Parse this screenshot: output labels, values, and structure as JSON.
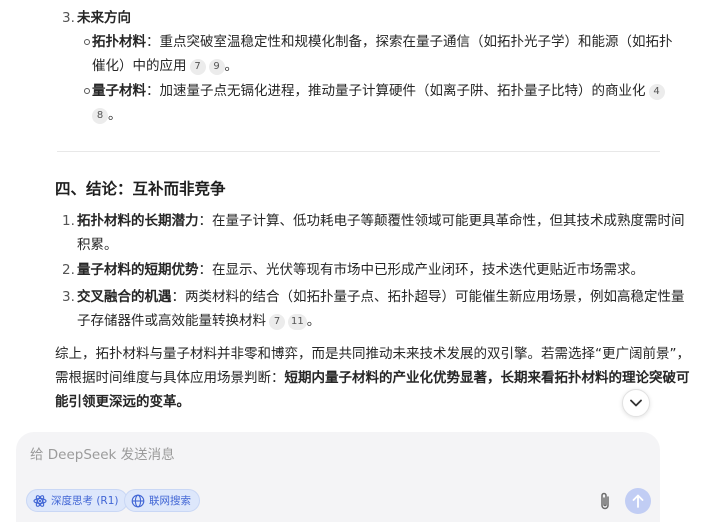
{
  "section3": {
    "num": "3.",
    "title": "未来方向",
    "items": [
      {
        "label": "拓扑材料",
        "text1": "：重点突破室温稳定性和规模化制备，探索在量子通信（如拓扑光子学）和能源（如拓扑",
        "text2": "催化）中的应用",
        "cites": [
          "7",
          "9"
        ],
        "end": "。"
      },
      {
        "label": "量子材料",
        "text1": "：加速量子点无镉化进程，推动量子计算硬件（如离子阱、拓扑量子比特）的商业化",
        "cites_a": [
          "4"
        ],
        "cites_b": [
          "8"
        ],
        "end": "。"
      }
    ]
  },
  "section4": {
    "title": "四、结论：互补而非竞争",
    "items": [
      {
        "num": "1.",
        "label": "拓扑材料的长期潜力",
        "text1": "：在量子计算、低功耗电子等颠覆性领域可能更具革命性，但其技术成熟度需时间",
        "text2": "积累。"
      },
      {
        "num": "2.",
        "label": "量子材料的短期优势",
        "text1": "：在显示、光伏等现有市场中已形成产业闭环，技术迭代更贴近市场需求。"
      },
      {
        "num": "3.",
        "label": "交叉融合的机遇",
        "text1": "：两类材料的结合（如拓扑量子点、拓扑超导）可能催生新应用场景，例如高稳定性量",
        "text2": "子存储器件或高效能量转换材料",
        "cites": [
          "7",
          "11"
        ],
        "end": "。"
      }
    ]
  },
  "summary": {
    "line1": "综上，拓扑材料与量子材料并非零和博弈，而是共同推动未来技术发展的双引擎。若需选择“更广阔前景”，",
    "line2_plain": "需根据时间维度与具体应用场景判断：",
    "line2_bold": "短期内量子材料的产业化优势显著，长期来看拓扑材料的理论突破可",
    "line3_bold": "能引领更深远的变革。"
  },
  "composer": {
    "placeholder": "给 DeepSeek 发送消息",
    "value": "",
    "deepthink_label": "深度思考 (R1)",
    "search_label": "联网搜索"
  },
  "colors": {
    "accent": "#4166d5",
    "pill_bg": "#dde7fb",
    "send_bg": "#c1cdf4",
    "composer_bg": "#f4f4f6"
  },
  "icons": {
    "deepthink": "atom-icon",
    "search": "globe-icon",
    "attach": "paperclip-icon",
    "send": "arrow-up-icon",
    "scroll": "chevron-down-icon"
  }
}
